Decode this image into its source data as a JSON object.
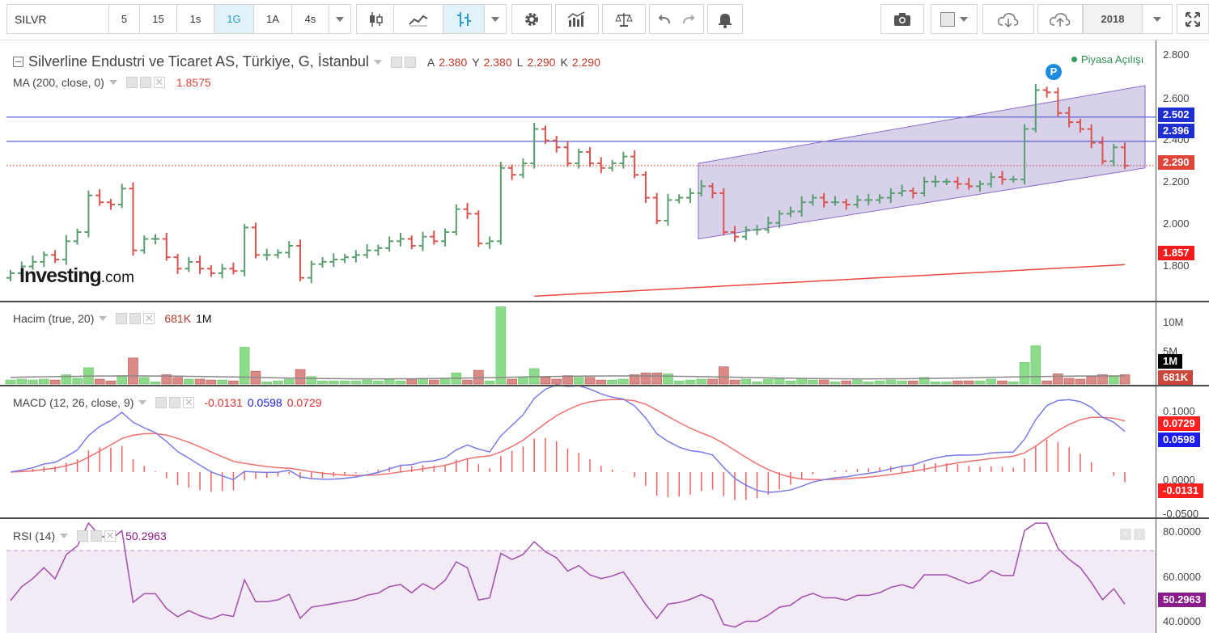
{
  "toolbar": {
    "symbol": "SILVR",
    "intervals": [
      "5",
      "15",
      "1s",
      "1G",
      "1A",
      "4s"
    ],
    "active_interval": "1G",
    "year_button": "2018"
  },
  "main": {
    "title": "Silverline Endustri ve Ticaret AS, Türkiye, G, İstanbul",
    "ohlc": {
      "A_label": "A",
      "A": "2.380",
      "Y_label": "Y",
      "Y": "2.380",
      "L_label": "L",
      "L": "2.290",
      "K_label": "K",
      "K": "2.290"
    },
    "market_status": "Piyasa Açılışı",
    "ma_label": "MA (200, close, 0)",
    "ma_value": "1.8575",
    "logo_text": "Investing",
    "logo_suffix": ".com",
    "marker": "P",
    "yticks": [
      "2.800",
      "2.600",
      "2.400",
      "2.200",
      "2.000",
      "1.800"
    ],
    "price_tags": [
      {
        "text": "2.502",
        "color": "#1f2ed1"
      },
      {
        "text": "2.396",
        "color": "#1f2ed1"
      },
      {
        "text": "2.290",
        "color": "#e0453a"
      },
      {
        "text": "1.857",
        "color": "#f21c1c"
      }
    ]
  },
  "volume": {
    "label": "Hacim (true, 20)",
    "value1": "681K",
    "value2": "1M",
    "yticks": [
      "10M",
      "5M"
    ],
    "tags": [
      {
        "text": "1M",
        "color": "#000000"
      },
      {
        "text": "681K",
        "color": "#c9463a"
      }
    ]
  },
  "macd": {
    "label": "MACD (12, 26, close, 9)",
    "hist_value": "-0.0131",
    "macd_value": "0.0598",
    "signal_value": "0.0729",
    "yticks": [
      "0.1000",
      "0.0500",
      "0.0000",
      "-0.0500"
    ],
    "tags": [
      {
        "text": "0.0729",
        "color": "#ff1f1f"
      },
      {
        "text": "0.0598",
        "color": "#1c1cf0"
      },
      {
        "text": "-0.0131",
        "color": "#ff1f1f"
      }
    ]
  },
  "rsi": {
    "label": "RSI (14)",
    "value": "50.2963",
    "yticks": [
      "80.0000",
      "60.0000",
      "40.0000"
    ],
    "tag": {
      "text": "50.2963",
      "color": "#8b1c8b"
    }
  },
  "chart_data": {
    "type": "line",
    "price_ylim": [
      1.7,
      2.83
    ],
    "ma200": {
      "name": "MA (200, close, 0)",
      "last": 1.8575
    },
    "horizontal_levels": [
      2.502,
      2.396,
      2.29
    ],
    "closes": [
      1.82,
      1.85,
      1.87,
      1.9,
      1.88,
      1.96,
      2.0,
      2.16,
      2.13,
      2.12,
      2.19,
      1.92,
      1.97,
      1.97,
      1.89,
      1.84,
      1.87,
      1.84,
      1.82,
      1.84,
      1.83,
      2.02,
      1.9,
      1.9,
      1.91,
      1.94,
      1.8,
      1.86,
      1.87,
      1.88,
      1.89,
      1.9,
      1.92,
      1.93,
      1.96,
      1.97,
      1.94,
      1.98,
      1.96,
      2.0,
      2.1,
      2.08,
      1.95,
      1.96,
      2.28,
      2.25,
      2.3,
      2.45,
      2.4,
      2.37,
      2.3,
      2.35,
      2.3,
      2.28,
      2.3,
      2.33,
      2.25,
      2.15,
      2.05,
      2.14,
      2.15,
      2.17,
      2.2,
      2.17,
      2.0,
      1.98,
      2.01,
      2.01,
      2.04,
      2.08,
      2.09,
      2.13,
      2.15,
      2.13,
      2.13,
      2.12,
      2.14,
      2.14,
      2.15,
      2.17,
      2.18,
      2.17,
      2.22,
      2.22,
      2.22,
      2.21,
      2.2,
      2.21,
      2.24,
      2.23,
      2.23,
      2.45,
      2.62,
      2.61,
      2.52,
      2.48,
      2.45,
      2.39,
      2.31,
      2.37,
      2.29
    ],
    "volume_ylim": [
      0,
      11000000
    ],
    "macd_ylim": [
      -0.06,
      0.115
    ],
    "rsi_ylim": [
      37,
      82
    ],
    "rsi_overbought": 70
  }
}
